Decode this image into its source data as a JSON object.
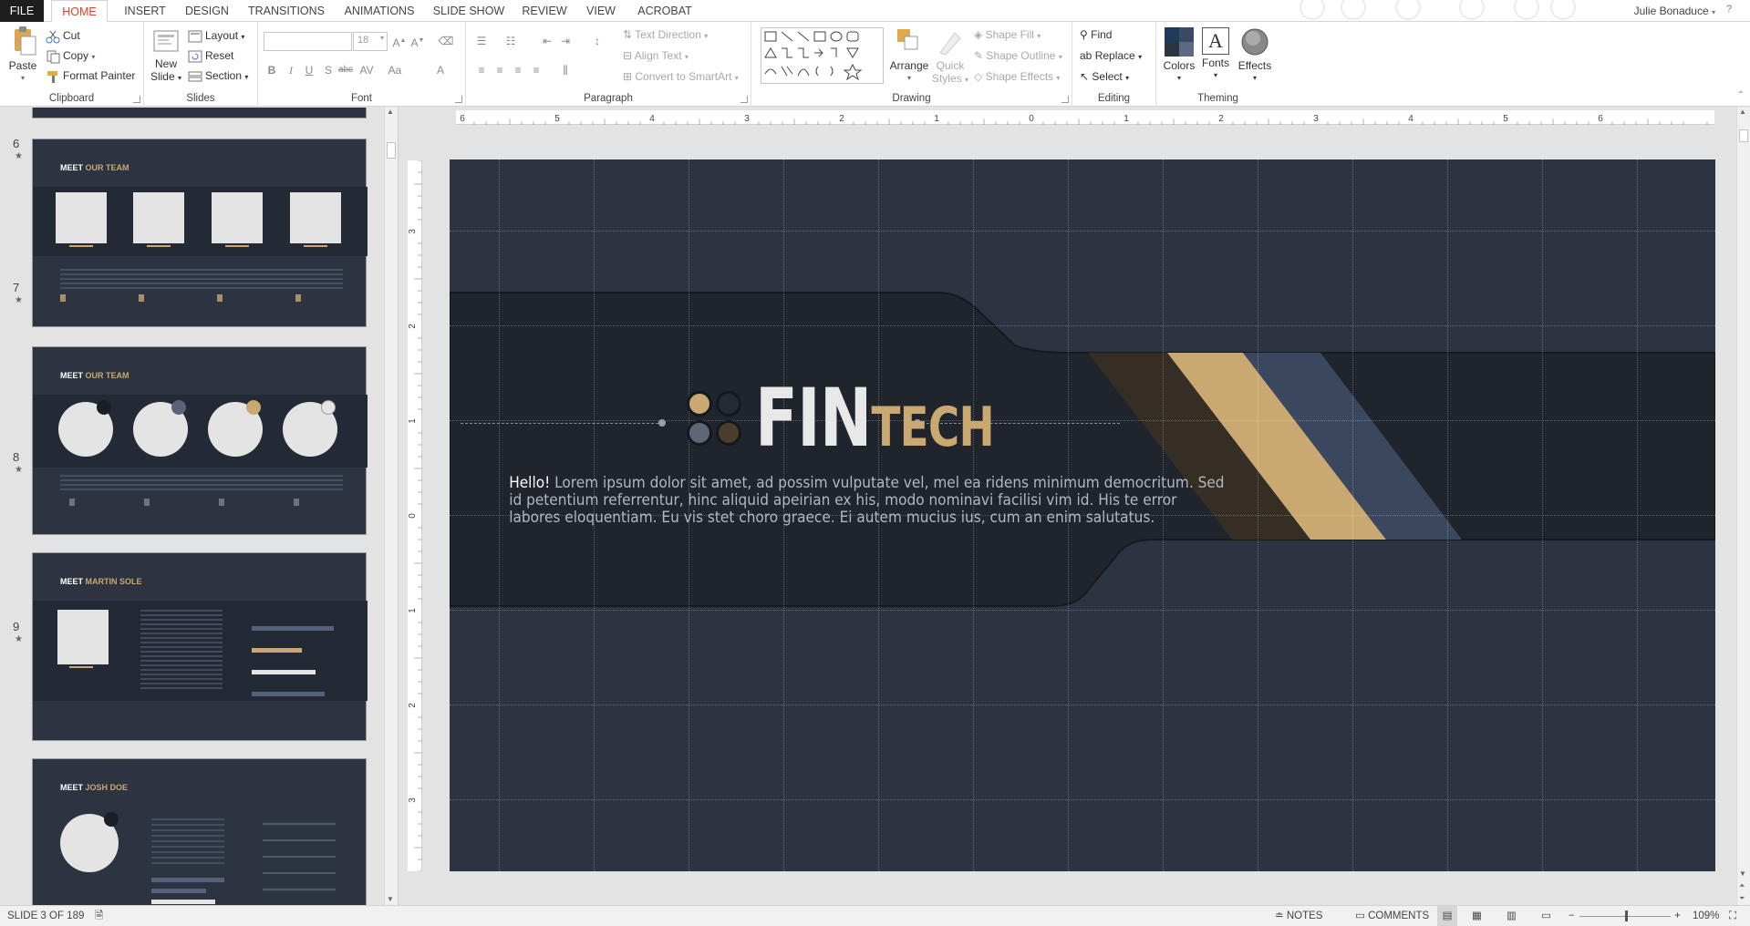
{
  "ribbon_tabs": {
    "file": "FILE",
    "home": "HOME",
    "insert": "INSERT",
    "design": "DESIGN",
    "transitions": "TRANSITIONS",
    "animations": "ANIMATIONS",
    "slide_show": "SLIDE SHOW",
    "review": "REVIEW",
    "view": "VIEW",
    "acrobat": "ACROBAT"
  },
  "user": {
    "name": "Julie Bonaduce"
  },
  "clipboard": {
    "label": "Clipboard",
    "paste": "Paste",
    "cut": "Cut",
    "copy": "Copy",
    "format_painter": "Format Painter"
  },
  "slides_group": {
    "label": "Slides",
    "new_slide_1": "New",
    "new_slide_2": "Slide",
    "layout": "Layout",
    "reset": "Reset",
    "section": "Section"
  },
  "font": {
    "label": "Font",
    "size": "18",
    "bold": "B",
    "italic": "I",
    "underline": "U",
    "shadow": "S",
    "strike": "abc"
  },
  "paragraph": {
    "label": "Paragraph",
    "text_direction": "Text Direction",
    "align_text": "Align Text",
    "convert_smartart": "Convert to SmartArt"
  },
  "drawing": {
    "label": "Drawing",
    "arrange": "Arrange",
    "quick_styles_1": "Quick",
    "quick_styles_2": "Styles",
    "shape_fill": "Shape Fill",
    "shape_outline": "Shape Outline",
    "shape_effects": "Shape Effects"
  },
  "editing": {
    "label": "Editing",
    "find": "Find",
    "replace": "Replace",
    "select": "Select"
  },
  "theming": {
    "label": "Theming",
    "colors": "Colors",
    "fonts": "Fonts",
    "effects": "Effects",
    "fonts_glyph": "A"
  },
  "thumbnails": [
    {
      "num": "6",
      "star": "★",
      "title_a": "MEET ",
      "title_b": "OUR TEAM"
    },
    {
      "num": "7",
      "star": "★",
      "title_a": "MEET ",
      "title_b": "OUR TEAM"
    },
    {
      "num": "8",
      "star": "★",
      "title_a": "MEET ",
      "title_b": "MARTIN SOLE"
    },
    {
      "num": "9",
      "star": "★",
      "title_a": "MEET ",
      "title_b": "JOSH DOE"
    }
  ],
  "hruler_labels": [
    "6",
    "5",
    "4",
    "3",
    "2",
    "1",
    "0",
    "1",
    "2",
    "3",
    "4",
    "5",
    "6"
  ],
  "vruler_labels": [
    "3",
    "2",
    "1",
    "0",
    "1",
    "2",
    "3"
  ],
  "slide": {
    "brand_fin": "FIN",
    "brand_tech": "TECH",
    "hello": "Hello!",
    "body_line1": " Lorem ipsum dolor sit amet, ad possim vulputate vel, mel ea ridens minimum democritum. Sed",
    "body_line2": "id petentium referrentur, hinc aliquid apeirian ex his, modo nominavi facilisi vim id. His te error",
    "body_line3": "labores eloquentiam. Eu vis stet choro graece. Ei autem mucius ius, cum an enim salutatus."
  },
  "colors": {
    "accent_tan": "#c9a872",
    "slide_dark": "#1f242d",
    "slide_mid": "#2c3442",
    "stripe_blue": "#3a475e",
    "office_orange": "#d24726"
  },
  "status": {
    "slide_of": "SLIDE 3 OF 189",
    "notes": "NOTES",
    "comments": "COMMENTS",
    "zoom": "109%"
  }
}
